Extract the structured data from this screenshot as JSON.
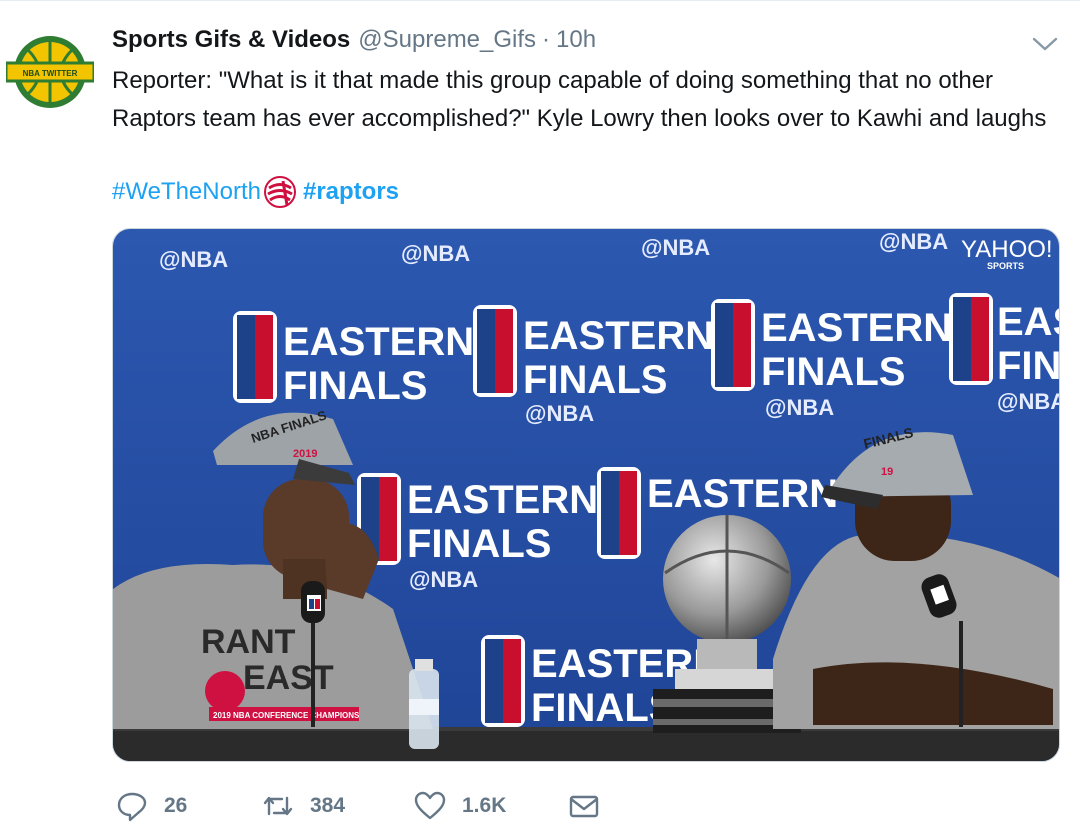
{
  "tweet": {
    "display_name": "Sports Gifs & Videos",
    "handle": "@Supreme_Gifs",
    "separator": "·",
    "timestamp": "10h",
    "avatar_label": "NBA TWITTER",
    "text": "Reporter: \"What is it that made this group capable of doing something that no other Raptors team has ever accomplished?\" Kyle Lowry then looks over to Kawhi and laughs",
    "hashtags": [
      "#WeTheNorth",
      "#raptors"
    ]
  },
  "media": {
    "watermark_brand": "YAHOO!",
    "watermark_sub": "SPORTS",
    "backdrop_handle": "@NBA",
    "backdrop_title_line1": "EASTERN",
    "backdrop_title_line2": "FINALS",
    "logo_text": "NBA",
    "shirt_line1": "RANT",
    "shirt_line2": "EAST",
    "shirt_small": "2019 NBA CONFERENCE CHAMPIONS",
    "cap_text": "NBA FINALS",
    "cap_year": "2019",
    "right_cap_text": "FINALS",
    "right_cap_year": "19"
  },
  "actions": {
    "replies": "26",
    "retweets": "384",
    "likes": "1.6K"
  },
  "colors": {
    "link": "#1da1f2",
    "secondary": "#657786",
    "backdrop": "#2a52a8",
    "avatar_green": "#2e7d32",
    "avatar_yellow": "#f2c500"
  }
}
